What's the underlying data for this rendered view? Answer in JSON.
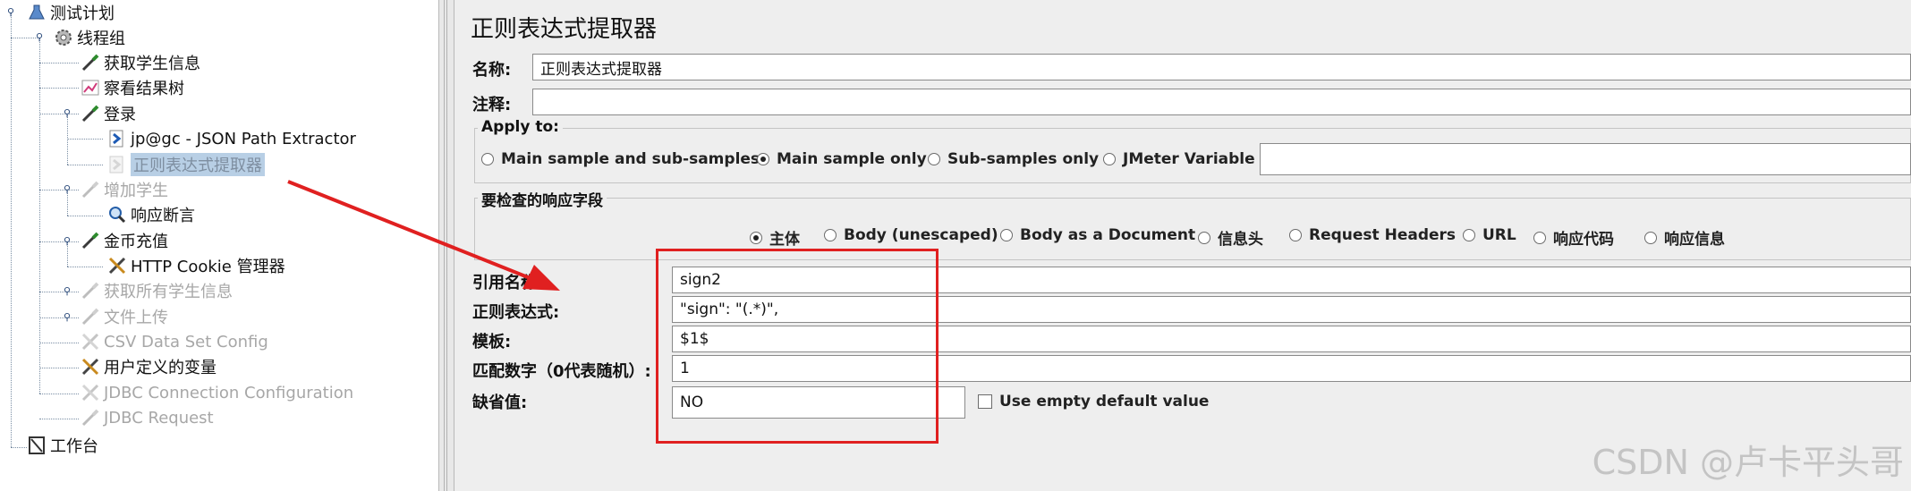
{
  "tree": {
    "items": [
      {
        "label": "测试计划",
        "icon": "flask-icon"
      },
      {
        "label": "线程组",
        "icon": "gear-icon"
      },
      {
        "label": "获取学生信息",
        "icon": "pipette-icon"
      },
      {
        "label": "察看结果树",
        "icon": "graph-icon"
      },
      {
        "label": "登录",
        "icon": "pipette-icon"
      },
      {
        "label": "jp@gc - JSON Path Extractor",
        "icon": "doc-arrow-icon"
      },
      {
        "label": "正则表达式提取器",
        "icon": "doc-arrow-icon"
      },
      {
        "label": "增加学生",
        "icon": "pipette-icon"
      },
      {
        "label": "响应断言",
        "icon": "magnifier-icon"
      },
      {
        "label": "金币充值",
        "icon": "pipette-icon"
      },
      {
        "label": "HTTP Cookie 管理器",
        "icon": "tools-icon"
      },
      {
        "label": "获取所有学生信息",
        "icon": "pipette-icon"
      },
      {
        "label": "文件上传",
        "icon": "pipette-icon"
      },
      {
        "label": "CSV Data Set Config",
        "icon": "tools-icon"
      },
      {
        "label": "用户定义的变量",
        "icon": "tools-icon"
      },
      {
        "label": "JDBC Connection Configuration",
        "icon": "tools-icon"
      },
      {
        "label": "JDBC Request",
        "icon": "pipette-icon"
      },
      {
        "label": "工作台",
        "icon": "workbench-icon"
      }
    ],
    "selected": "正则表达式提取器"
  },
  "panel": {
    "title": "正则表达式提取器",
    "name_label": "名称:",
    "name_value": "正则表达式提取器",
    "comment_label": "注释:",
    "comment_value": "",
    "apply_to": {
      "title": "Apply to:",
      "options": [
        "Main sample and sub-samples",
        "Main sample only",
        "Sub-samples only",
        "JMeter Variable"
      ],
      "selected": "Main sample only",
      "variable_value": ""
    },
    "response_field": {
      "title": "要检查的响应字段",
      "options": [
        "主体",
        "Body (unescaped)",
        "Body as a Document",
        "信息头",
        "Request Headers",
        "URL",
        "响应代码",
        "响应信息"
      ],
      "selected": "主体"
    },
    "ref_name_label": "引用名称:",
    "ref_name_value": "sign2",
    "regex_label": "正则表达式:",
    "regex_value": "\"sign\": \"(.*)\",",
    "template_label": "模板:",
    "template_value": "$1$",
    "match_no_label": "匹配数字（0代表随机）:",
    "match_no_value": "1",
    "default_label": "缺省值:",
    "default_value": "NO",
    "use_empty_label": "Use empty default value",
    "use_empty_checked": false
  },
  "watermark": "CSDN @卢卡平头哥",
  "colors": {
    "annotation_red": "#e02020",
    "selection_blue": "#b8cfe5"
  }
}
